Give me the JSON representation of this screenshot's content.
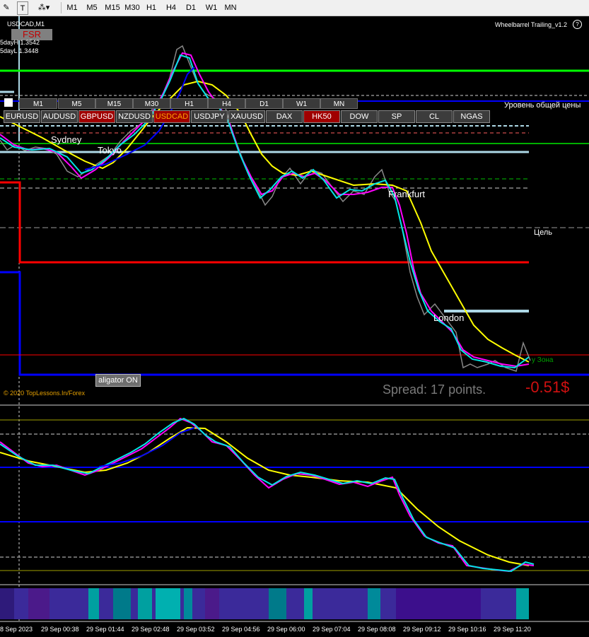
{
  "toolbar": {
    "timeframes": [
      "M1",
      "M5",
      "M15",
      "M30",
      "H1",
      "H4",
      "D1",
      "W1",
      "MN"
    ]
  },
  "chart": {
    "symbol_title": "USDCAD,M1",
    "fsr_label": "FSR",
    "price_notes": [
      "5dayH 1.3542",
      "5dayL 1.3448"
    ],
    "indicator_name": "Wheelbarrel Trailing_v1.2",
    "timeframe_buttons": [
      "M1",
      "M5",
      "M15",
      "M30",
      "H1",
      "H4",
      "D1",
      "W1",
      "MN"
    ],
    "symbol_buttons": [
      {
        "label": "EURUSD",
        "state": "normal"
      },
      {
        "label": "AUDUSD",
        "state": "normal"
      },
      {
        "label": "GBPUSD",
        "state": "red"
      },
      {
        "label": "NZDUSD",
        "state": "normal"
      },
      {
        "label": "USDCAD",
        "state": "active"
      },
      {
        "label": "USDJPY",
        "state": "normal"
      },
      {
        "label": "XAUUSD",
        "state": "normal"
      },
      {
        "label": "DAX",
        "state": "normal"
      },
      {
        "label": "HK50",
        "state": "red"
      },
      {
        "label": "DOW",
        "state": "normal"
      },
      {
        "label": "SP",
        "state": "normal"
      },
      {
        "label": "CL",
        "state": "normal"
      },
      {
        "label": "NGAS",
        "state": "normal"
      }
    ],
    "sessions": [
      "Sydney",
      "Tokyo",
      "Frankfurt",
      "London"
    ],
    "level_label": "Уровень общей цены",
    "target_label": "Цель",
    "zone_label": "у Зона",
    "aligator_button": "aligator ON",
    "copyright": "© 2020 TopLessons.In/Forex",
    "spread": "Spread: 17 points.",
    "profit": "-0.51$",
    "time_labels": [
      "8 Sep 2023",
      "29 Sep 00:38",
      "29 Sep 01:44",
      "29 Sep 02:48",
      "29 Sep 03:52",
      "29 Sep 04:56",
      "29 Sep 06:00",
      "29 Sep 07:04",
      "29 Sep 08:08",
      "29 Sep 09:12",
      "29 Sep 10:16",
      "29 Sep 11:20"
    ]
  },
  "colors": {
    "ma_yellow": "#ffff00",
    "ma_magenta": "#ff00ff",
    "ma_cyan": "#00e5e5",
    "ma_blue": "#0000ff",
    "level_green": "#00ff00",
    "level_red": "#ff0000",
    "level_lightblue": "#add8e6"
  },
  "chart_data": {
    "type": "line",
    "title": "USDCAD,M1",
    "x_labels": [
      "8 Sep 2023",
      "29 Sep 00:38",
      "29 Sep 01:44",
      "29 Sep 02:48",
      "29 Sep 03:52",
      "29 Sep 04:56",
      "29 Sep 06:00",
      "29 Sep 07:04",
      "29 Sep 08:08",
      "29 Sep 09:12",
      "29 Sep 10:16",
      "29 Sep 11:20"
    ],
    "series": []
  }
}
